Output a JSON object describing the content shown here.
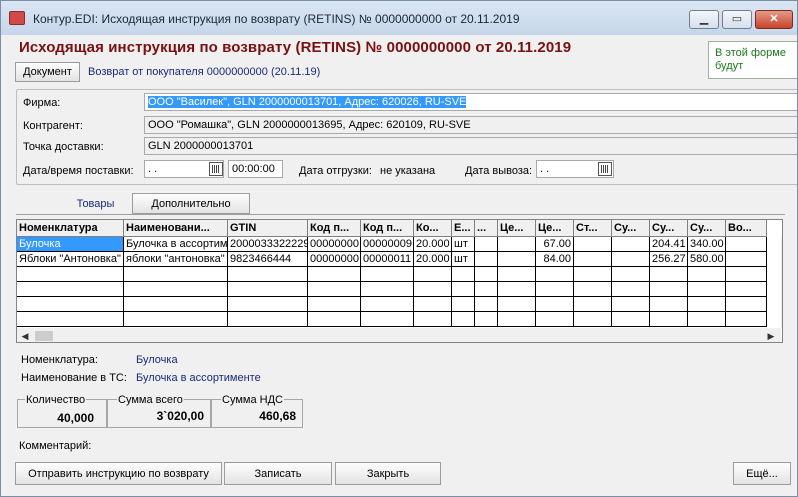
{
  "window": {
    "title": "Контур.EDI: Исходящая инструкция по возврату (RETINS) № 0000000000 от 20.11.2019",
    "controls": [
      "minimize-icon",
      "maximize-icon",
      "close-icon"
    ]
  },
  "header": {
    "title": "Исходящая инструкция по возврату (RETINS) № 0000000000 от 20.11.2019",
    "document_button": "Документ",
    "document_link": "Возврат от покупателя 0000000000 (20.11.19)",
    "hint": "В этой форме\nбудут"
  },
  "form": {
    "firm_label": "Фирма:",
    "firm_value": "ООО \"Василек\", GLN 2000000013701, Адрес: 620026, RU-SVE",
    "contractor_label": "Контрагент:",
    "contractor_value": "ООО \"Ромашка\", GLN 2000000013695, Адрес: 620109, RU-SVE",
    "delivery_point_label": "Точка доставки:",
    "delivery_point_value": "GLN 2000000013701",
    "delivery_datetime_label": "Дата/время поставки:",
    "delivery_date_value": " .  .",
    "delivery_time_value": "00:00:00",
    "shipping_date_label": "Дата отгрузки:",
    "shipping_date_value": "не указана",
    "removal_date_label": "Дата вывоза:",
    "removal_date_value": " .  ."
  },
  "tabs": {
    "goods": "Товары",
    "additional": "Дополнительно"
  },
  "table": {
    "headers": [
      "Номенклатура",
      "Наименовани...",
      "GTIN",
      "Код п...",
      "Код п...",
      "Ко...",
      "Е...",
      "...",
      "Це...",
      "Це...",
      "Ст...",
      "Су...",
      "Су...",
      "Су...",
      "Во..."
    ],
    "rows": [
      [
        "Булочка",
        "Булочка в ассортим",
        "2000033322229",
        "00000000",
        "00000009",
        "20.000",
        "шт",
        "",
        "",
        "67.00",
        "",
        "",
        "204.41",
        "340.00",
        ""
      ],
      [
        "Яблоки \"Антоновка\"",
        "яблоки \"антоновка\"",
        "9823466444",
        "00000000",
        "00000011",
        "20.000",
        "шт",
        "",
        "",
        "84.00",
        "",
        "",
        "256.27",
        "580.00",
        ""
      ]
    ]
  },
  "details": {
    "nomenclature_label": "Номенклатура:",
    "nomenclature_value": "Булочка",
    "tc_name_label": "Наименование в ТС:",
    "tc_name_value": "Булочка в ассортименте"
  },
  "totals": {
    "qty_label": "Количество",
    "qty_value": "40,000",
    "sum_label": "Сумма всего",
    "sum_value": "3`020,00",
    "vat_label": "Сумма НДС",
    "vat_value": "460,68"
  },
  "comment_label": "Комментарий:",
  "footer": {
    "send_button": "Отправить инструкцию по возврату",
    "save_button": "Записать",
    "close_button": "Закрыть",
    "more_button": "Ещё..."
  },
  "colors": {
    "title_red": "#7a1010",
    "link_blue": "#1a2a78",
    "selection": "#3399ff",
    "hint_green": "#1a7a1a"
  }
}
